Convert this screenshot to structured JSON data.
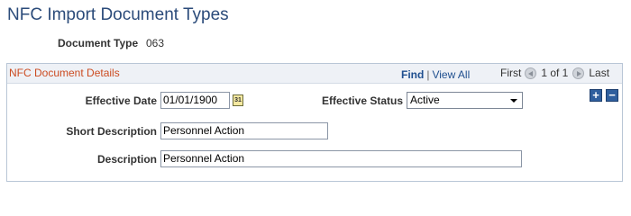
{
  "page": {
    "title": "NFC Import Document Types"
  },
  "document_type": {
    "label": "Document Type",
    "value": "063"
  },
  "panel": {
    "title": "NFC Document Details",
    "find_label": "Find",
    "separator": "|",
    "view_all_label": "View All",
    "first_label": "First",
    "count_text": "1 of 1",
    "last_label": "Last"
  },
  "fields": {
    "effective_date": {
      "label": "Effective Date",
      "value": "01/01/1900"
    },
    "calendar_icon_text": "31",
    "effective_status": {
      "label": "Effective Status",
      "value": "Active"
    },
    "short_description": {
      "label": "Short Description",
      "value": "Personnel Action"
    },
    "description": {
      "label": "Description",
      "value": "Personnel Action"
    }
  },
  "row_buttons": {
    "add_symbol": "+",
    "delete_symbol": "−"
  },
  "icons": {
    "prev": "chevron-left-circle-icon",
    "next": "chevron-right-circle-icon",
    "calendar": "calendar-icon",
    "add": "plus-icon",
    "delete": "minus-icon"
  },
  "colors": {
    "title": "#2b4b7a",
    "panel_title": "#cc4c22",
    "link": "#1f4f8f",
    "panel_header_bg": "#eef1f6",
    "panel_border": "#b9c6d6",
    "button_bg": "#2f5f9e"
  }
}
